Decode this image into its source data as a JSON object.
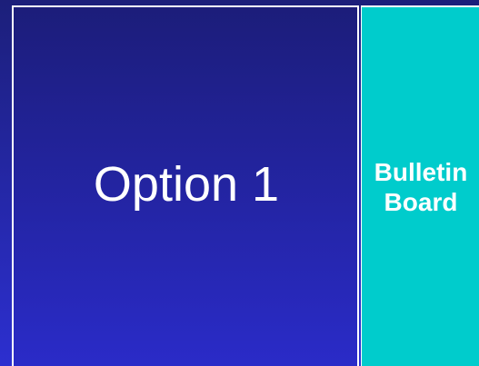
{
  "main": {
    "label": "Option 1"
  },
  "bulletin": {
    "line1": "Bulletin",
    "line2": "Board"
  },
  "colors": {
    "main_top": "#1c1d7a",
    "main_bottom": "#2a2bc8",
    "bulletin_bg": "#00cccc",
    "text": "#ffffff"
  }
}
